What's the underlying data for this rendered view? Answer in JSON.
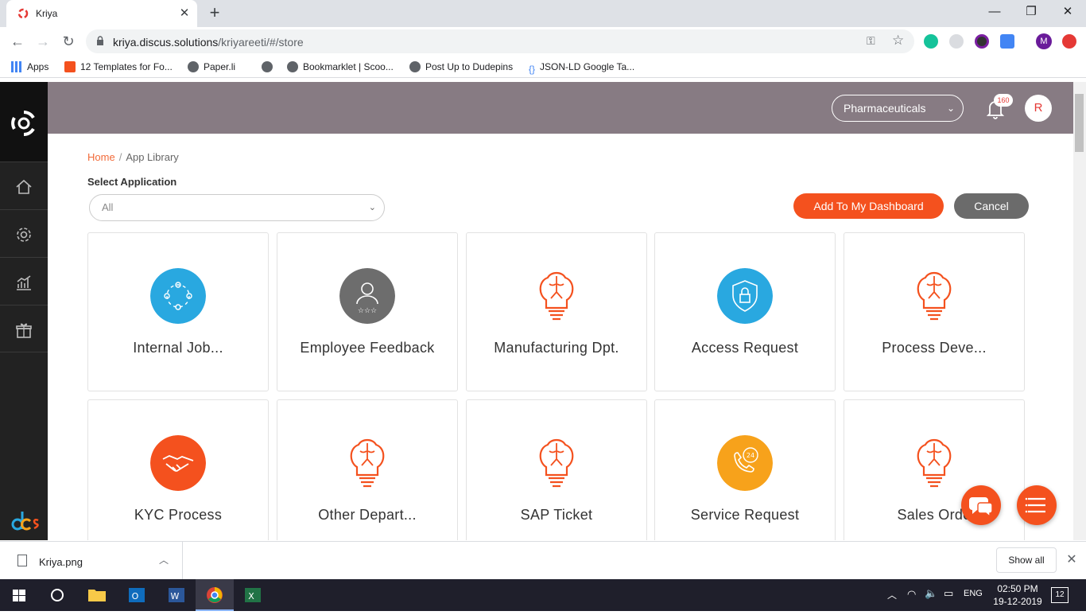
{
  "browser": {
    "tab_title": "Kriya",
    "url_host": "kriya.discus.solutions",
    "url_path": "/kriyareeti/#/store",
    "bookmarks": [
      {
        "label": "Apps"
      },
      {
        "label": "12 Templates for Fo..."
      },
      {
        "label": "Paper.li"
      },
      {
        "label": ""
      },
      {
        "label": "Bookmarklet | Scoo..."
      },
      {
        "label": "Post Up to Dudepins"
      },
      {
        "label": "JSON-LD Google Ta..."
      }
    ],
    "profile_initial": "M"
  },
  "header": {
    "industry": "Pharmaceuticals",
    "notification_count": "160",
    "user_initial": "R"
  },
  "breadcrumb": {
    "home": "Home",
    "current": "App Library"
  },
  "filter": {
    "label": "Select Application",
    "value": "All"
  },
  "actions": {
    "add": "Add To My Dashboard",
    "cancel": "Cancel"
  },
  "apps": [
    {
      "name": "Internal Job...",
      "icon": "users-network-icon",
      "color": "#29a8e0"
    },
    {
      "name": "Employee Feedback",
      "icon": "employee-rating-icon",
      "color": "#6d6d6d"
    },
    {
      "name": "Manufacturing Dpt.",
      "icon": "brain-bulb-icon",
      "color": "#f4511e"
    },
    {
      "name": "Access Request",
      "icon": "shield-lock-icon",
      "color": "#29a8e0"
    },
    {
      "name": "Process Deve...",
      "icon": "brain-bulb-icon",
      "color": "#f4511e"
    },
    {
      "name": "KYC Process",
      "icon": "handshake-icon",
      "color": "#f4511e"
    },
    {
      "name": "Other Depart...",
      "icon": "brain-bulb-icon",
      "color": "#f4511e"
    },
    {
      "name": "SAP Ticket",
      "icon": "brain-bulb-icon",
      "color": "#f4511e"
    },
    {
      "name": "Service Request",
      "icon": "phone-24-icon",
      "color": "#f7a21b"
    },
    {
      "name": "Sales Orde",
      "icon": "brain-bulb-icon",
      "color": "#f4511e"
    }
  ],
  "downloads": {
    "file": "Kriya.png",
    "show_all": "Show all"
  },
  "taskbar": {
    "time": "02:50 PM",
    "date": "19-12-2019",
    "lang": "ENG",
    "notif": "12"
  }
}
